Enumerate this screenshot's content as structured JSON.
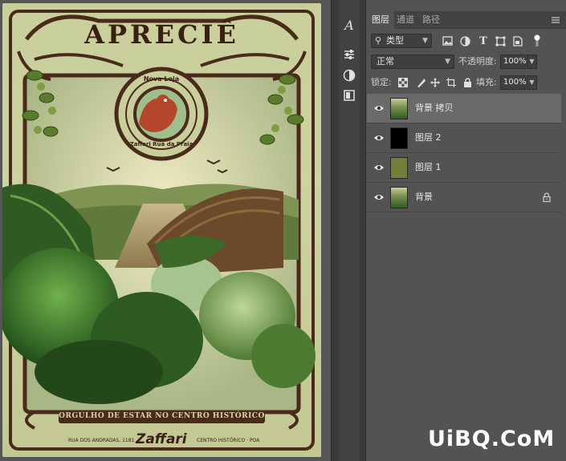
{
  "poster": {
    "title": "APRECIÊ",
    "seal_top": "Nova Loja",
    "seal_bottom": "Zaffari Rua da Praia",
    "banner": "ORGULHO DE ESTAR NO CENTRO HISTÓRICO",
    "footer_left": "RUA DOS ANDRADAS, 1181",
    "brand": "Zaffari",
    "footer_right": "CENTRO HISTÓRICO · POA"
  },
  "panel": {
    "tabs": [
      {
        "label": "图层",
        "active": true
      },
      {
        "label": "通道",
        "active": false
      },
      {
        "label": "路径",
        "active": false
      }
    ],
    "filter": {
      "label": "类型"
    },
    "blend_mode": "正常",
    "opacity_label": "不透明度:",
    "opacity_value": "100%",
    "lock_label": "锁定:",
    "fill_label": "填充:",
    "fill_value": "100%"
  },
  "layers": [
    {
      "name": "背景 拷贝",
      "selected": true,
      "thumb": "poster",
      "locked": false
    },
    {
      "name": "图层 2",
      "selected": false,
      "thumb": "#000000",
      "locked": false
    },
    {
      "name": "图层 1",
      "selected": false,
      "thumb": "#6f7f3a",
      "locked": false
    },
    {
      "name": "背景",
      "selected": false,
      "thumb": "poster",
      "locked": true
    }
  ],
  "tools": [
    "type-tool-icon",
    "adjustments-icon",
    "color-circle-icon",
    "paths-icon"
  ],
  "watermark": "UiBQ.CoM",
  "colors": {
    "panel_bg": "#535353",
    "selected_layer": "#6a6a6a",
    "poster_brown": "#4a2a1a",
    "poster_bg": "#c9cf9b",
    "layer1_olive": "#6f7f3a"
  }
}
